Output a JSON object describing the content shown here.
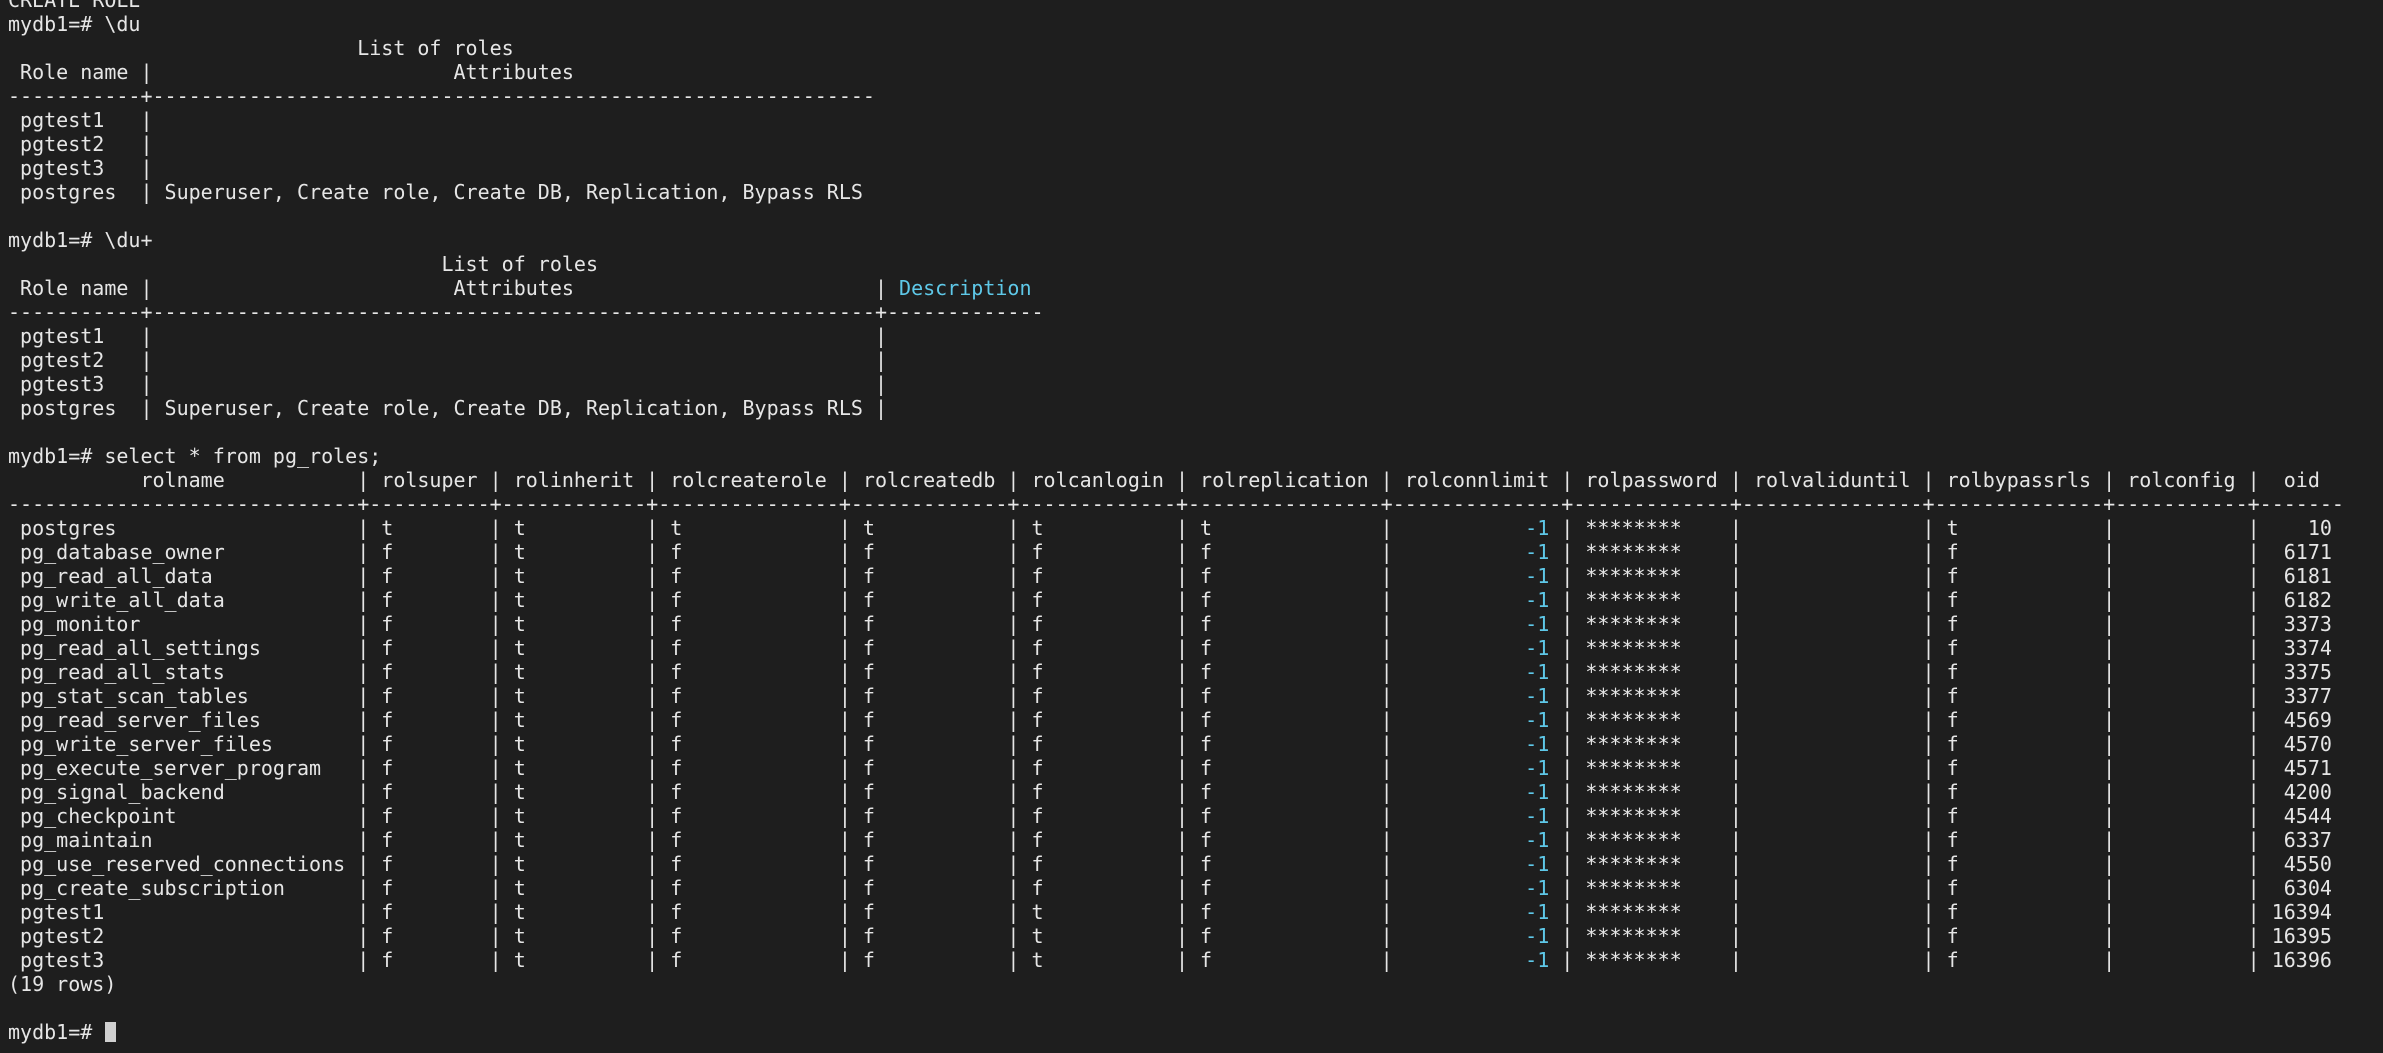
{
  "terminal": {
    "colors": {
      "background": "#1e1e1e",
      "foreground": "#e6e6e6",
      "highlight": "#5ec8e8",
      "cursor": "#d0d0d0"
    },
    "lines": [
      {
        "text": "CREATE ROLE"
      },
      {
        "text": "mydb1=# \\du"
      },
      {
        "text": "                             List of roles"
      },
      {
        "text": " Role name |                         Attributes"
      },
      {
        "text": "-----------+------------------------------------------------------------"
      },
      {
        "text": " pgtest1   |"
      },
      {
        "text": " pgtest2   |"
      },
      {
        "text": " pgtest3   |"
      },
      {
        "text": " postgres  | Superuser, Create role, Create DB, Replication, Bypass RLS"
      },
      {
        "text": ""
      },
      {
        "text": "mydb1=# \\du+"
      },
      {
        "text": "                                    List of roles"
      },
      {
        "text": " Role name |                         Attributes                         | ",
        "hl": "Description"
      },
      {
        "text": "-----------+------------------------------------------------------------+-------------"
      },
      {
        "text": " pgtest1   |                                                            |"
      },
      {
        "text": " pgtest2   |                                                            |"
      },
      {
        "text": " pgtest3   |                                                            |"
      },
      {
        "text": " postgres  | Superuser, Create role, Create DB, Replication, Bypass RLS |"
      },
      {
        "text": ""
      },
      {
        "text": "mydb1=# select * from pg_roles;"
      },
      {
        "text": "           rolname           | rolsuper | rolinherit | rolcreaterole | rolcreatedb | rolcanlogin | rolreplication | rolconnlimit | rolpassword | rolvaliduntil | rolbypassrls | rolconfig |  oid"
      },
      {
        "text": "-----------------------------+----------+------------+---------------+-------------+-------------+----------------+--------------+-------------+---------------+--------------+-----------+-------"
      },
      {
        "text": " postgres                    | t        | t          | t             | t           | t           | t              |           ",
        "hl": "-1",
        "after": " | ********    |               | t            |           |    10"
      },
      {
        "text": " pg_database_owner           | f        | t          | f             | f           | f           | f              |           ",
        "hl": "-1",
        "after": " | ********    |               | f            |           |  6171"
      },
      {
        "text": " pg_read_all_data            | f        | t          | f             | f           | f           | f              |           ",
        "hl": "-1",
        "after": " | ********    |               | f            |           |  6181"
      },
      {
        "text": " pg_write_all_data           | f        | t          | f             | f           | f           | f              |           ",
        "hl": "-1",
        "after": " | ********    |               | f            |           |  6182"
      },
      {
        "text": " pg_monitor                  | f        | t          | f             | f           | f           | f              |           ",
        "hl": "-1",
        "after": " | ********    |               | f            |           |  3373"
      },
      {
        "text": " pg_read_all_settings        | f        | t          | f             | f           | f           | f              |           ",
        "hl": "-1",
        "after": " | ********    |               | f            |           |  3374"
      },
      {
        "text": " pg_read_all_stats           | f        | t          | f             | f           | f           | f              |           ",
        "hl": "-1",
        "after": " | ********    |               | f            |           |  3375"
      },
      {
        "text": " pg_stat_scan_tables         | f        | t          | f             | f           | f           | f              |           ",
        "hl": "-1",
        "after": " | ********    |               | f            |           |  3377"
      },
      {
        "text": " pg_read_server_files        | f        | t          | f             | f           | f           | f              |           ",
        "hl": "-1",
        "after": " | ********    |               | f            |           |  4569"
      },
      {
        "text": " pg_write_server_files       | f        | t          | f             | f           | f           | f              |           ",
        "hl": "-1",
        "after": " | ********    |               | f            |           |  4570"
      },
      {
        "text": " pg_execute_server_program   | f        | t          | f             | f           | f           | f              |           ",
        "hl": "-1",
        "after": " | ********    |               | f            |           |  4571"
      },
      {
        "text": " pg_signal_backend           | f        | t          | f             | f           | f           | f              |           ",
        "hl": "-1",
        "after": " | ********    |               | f            |           |  4200"
      },
      {
        "text": " pg_checkpoint               | f        | t          | f             | f           | f           | f              |           ",
        "hl": "-1",
        "after": " | ********    |               | f            |           |  4544"
      },
      {
        "text": " pg_maintain                 | f        | t          | f             | f           | f           | f              |           ",
        "hl": "-1",
        "after": " | ********    |               | f            |           |  6337"
      },
      {
        "text": " pg_use_reserved_connections | f        | t          | f             | f           | f           | f              |           ",
        "hl": "-1",
        "after": " | ********    |               | f            |           |  4550"
      },
      {
        "text": " pg_create_subscription      | f        | t          | f             | f           | f           | f              |           ",
        "hl": "-1",
        "after": " | ********    |               | f            |           |  6304"
      },
      {
        "text": " pgtest1                     | f        | t          | f             | f           | t           | f              |           ",
        "hl": "-1",
        "after": " | ********    |               | f            |           | 16394"
      },
      {
        "text": " pgtest2                     | f        | t          | f             | f           | t           | f              |           ",
        "hl": "-1",
        "after": " | ********    |               | f            |           | 16395"
      },
      {
        "text": " pgtest3                     | f        | t          | f             | f           | t           | f              |           ",
        "hl": "-1",
        "after": " | ********    |               | f            |           | 16396"
      },
      {
        "text": "(19 rows)"
      },
      {
        "text": ""
      },
      {
        "text": "mydb1=# ",
        "cursor": true
      }
    ]
  }
}
